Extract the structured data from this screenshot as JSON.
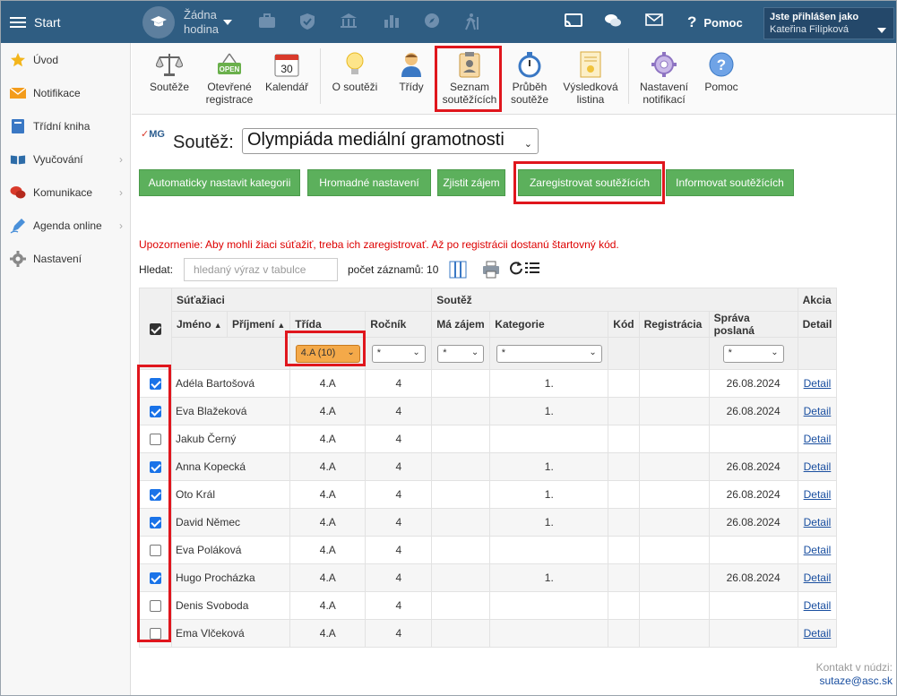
{
  "topbar": {
    "start": "Start",
    "lesson": "Žádna hodina",
    "help": "Pomoc",
    "user_label": "Jste přihlášen jako",
    "user_name": "Kateřina Filípková"
  },
  "sidebar": {
    "items": [
      {
        "label": "Úvod",
        "icon": "star-icon"
      },
      {
        "label": "Notifikace",
        "icon": "envelope-icon"
      },
      {
        "label": "Třídní kniha",
        "icon": "book-icon"
      },
      {
        "label": "Vyučování",
        "icon": "open-book-icon"
      },
      {
        "label": "Komunikace",
        "icon": "chat-icon"
      },
      {
        "label": "Agenda online",
        "icon": "pen-icon"
      },
      {
        "label": "Nastavení",
        "icon": "gear-icon"
      }
    ]
  },
  "toolbar": {
    "souteze": "Soutěže",
    "otevrene1": "Otevřené",
    "otevrene2": "registrace",
    "open_badge": "OPEN",
    "kalendar": "Kalendář",
    "cal_num": "30",
    "o_soutezi": "O soutěži",
    "tridy": "Třídy",
    "seznam1": "Seznam",
    "seznam2": "soutěžících",
    "prubeh1": "Průběh",
    "prubeh2": "soutěže",
    "vysl1": "Výsledková",
    "vysl2": "listina",
    "nast1": "Nastavení",
    "nast2": "notifikací",
    "pomoc": "Pomoc"
  },
  "competition": {
    "logo": "MG",
    "label": "Soutěž:",
    "selected": "Olympiáda mediální gramotnosti"
  },
  "buttons": {
    "auto": "Automaticky nastavit kategorii",
    "bulk": "Hromadné nastavení",
    "interest": "Zjistit zájem",
    "register": "Zaregistrovat soutěžících",
    "inform": "Informovat soutěžících"
  },
  "warning": "Upozornenie: Aby mohli žiaci súťažiť, treba ich zaregistrovať. Až po registrácii dostanú štartovný kód.",
  "search": {
    "label": "Hledat:",
    "placeholder": "hledaný výraz v tabulce",
    "count": "počet záznamů: 10"
  },
  "table": {
    "group_students": "Súťažiaci",
    "group_competition": "Soutěž",
    "group_action": "Akcia",
    "col_name": "Jméno",
    "col_surname": "Příjmení",
    "col_class": "Třída",
    "col_grade": "Ročník",
    "col_interest": "Má zájem",
    "col_category": "Kategorie",
    "col_code": "Kód",
    "col_registration": "Registrácia",
    "col_sent": "Správa poslaná",
    "col_detail": "Detail",
    "filter_class": "4.A (10)",
    "filter_any": "*",
    "rows": [
      {
        "name": "Adéla Bartošová",
        "class": "4.A",
        "grade": "4",
        "category": "1.",
        "sent": "26.08.2024",
        "checked": true,
        "detail": "Detail"
      },
      {
        "name": "Eva Blažeková",
        "class": "4.A",
        "grade": "4",
        "category": "1.",
        "sent": "26.08.2024",
        "checked": true,
        "detail": "Detail"
      },
      {
        "name": "Jakub Černý",
        "class": "4.A",
        "grade": "4",
        "category": "",
        "sent": "",
        "checked": false,
        "detail": "Detail"
      },
      {
        "name": "Anna Kopecká",
        "class": "4.A",
        "grade": "4",
        "category": "1.",
        "sent": "26.08.2024",
        "checked": true,
        "detail": "Detail"
      },
      {
        "name": "Oto Král",
        "class": "4.A",
        "grade": "4",
        "category": "1.",
        "sent": "26.08.2024",
        "checked": true,
        "detail": "Detail"
      },
      {
        "name": "David Němec",
        "class": "4.A",
        "grade": "4",
        "category": "1.",
        "sent": "26.08.2024",
        "checked": true,
        "detail": "Detail"
      },
      {
        "name": "Eva Poláková",
        "class": "4.A",
        "grade": "4",
        "category": "",
        "sent": "",
        "checked": false,
        "detail": "Detail"
      },
      {
        "name": "Hugo Procházka",
        "class": "4.A",
        "grade": "4",
        "category": "1.",
        "sent": "26.08.2024",
        "checked": true,
        "detail": "Detail"
      },
      {
        "name": "Denis Svoboda",
        "class": "4.A",
        "grade": "4",
        "category": "",
        "sent": "",
        "checked": false,
        "detail": "Detail"
      },
      {
        "name": "Ema Vlčeková",
        "class": "4.A",
        "grade": "4",
        "category": "",
        "sent": "",
        "checked": false,
        "detail": "Detail"
      }
    ]
  },
  "footer": {
    "contact": "Kontakt v núdzi:",
    "email": "sutaze@asc.sk"
  },
  "colors": {
    "header": "#2f5d82",
    "green": "#5cb05c",
    "highlight": "#e0161d",
    "filter": "#f4a949"
  }
}
